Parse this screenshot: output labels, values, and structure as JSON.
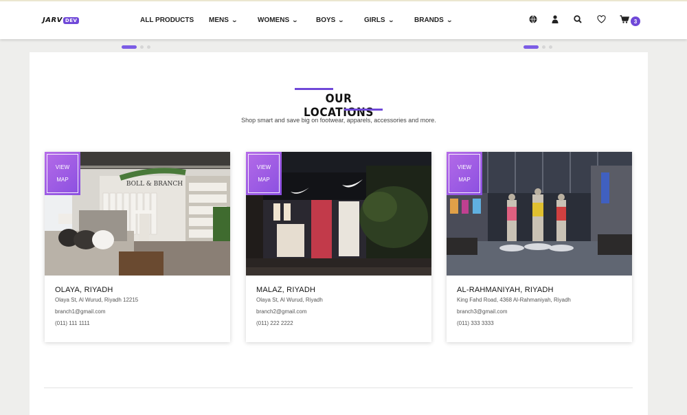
{
  "brand": {
    "logo_text": "JARV",
    "logo_badge": "DEV"
  },
  "nav": [
    {
      "label": "ALL PRODUCTS",
      "has_dropdown": false
    },
    {
      "label": "MENS",
      "has_dropdown": true
    },
    {
      "label": "WOMENS",
      "has_dropdown": true
    },
    {
      "label": "BOYS",
      "has_dropdown": true
    },
    {
      "label": "GIRLS",
      "has_dropdown": true
    },
    {
      "label": "BRANDS",
      "has_dropdown": true
    }
  ],
  "header_icons": [
    "globe-icon",
    "user-icon",
    "search-icon",
    "heart-icon",
    "cart-icon"
  ],
  "cart": {
    "count": "3"
  },
  "carousels": [
    {
      "total": 3,
      "active": 1
    },
    {
      "total": 3,
      "active": 1
    }
  ],
  "section": {
    "title": "OUR LOCATIONS",
    "subtitle": "Shop smart and save big on footwear, apparels, accessories and more."
  },
  "view_map": {
    "line1": "VIEW",
    "line2": "MAP"
  },
  "locations": [
    {
      "name": "OLAYA, RIYADH",
      "address": "Olaya St, Al Wurud, Riyadh 12215",
      "email": "branch1@gmail.com",
      "phone": "(011) 111 1111",
      "store_sign": "BOLL & BRANCH"
    },
    {
      "name": "MALAZ, RIYADH",
      "address": "Olaya St, Al Wurud, Riyadh",
      "email": "branch2@gmail.com",
      "phone": "(011) 222 2222"
    },
    {
      "name": "AL-RAHMANIYAH, RIYADH",
      "address": "King Fahd Road, 4368 Al-Rahmaniyah, Riyadh",
      "email": "branch3@gmail.com",
      "phone": "(011) 333 3333"
    }
  ],
  "colors": {
    "accent": "#6f48d8",
    "view_map_bg": "#9b5ce4",
    "page_bg": "#eeeeec"
  }
}
